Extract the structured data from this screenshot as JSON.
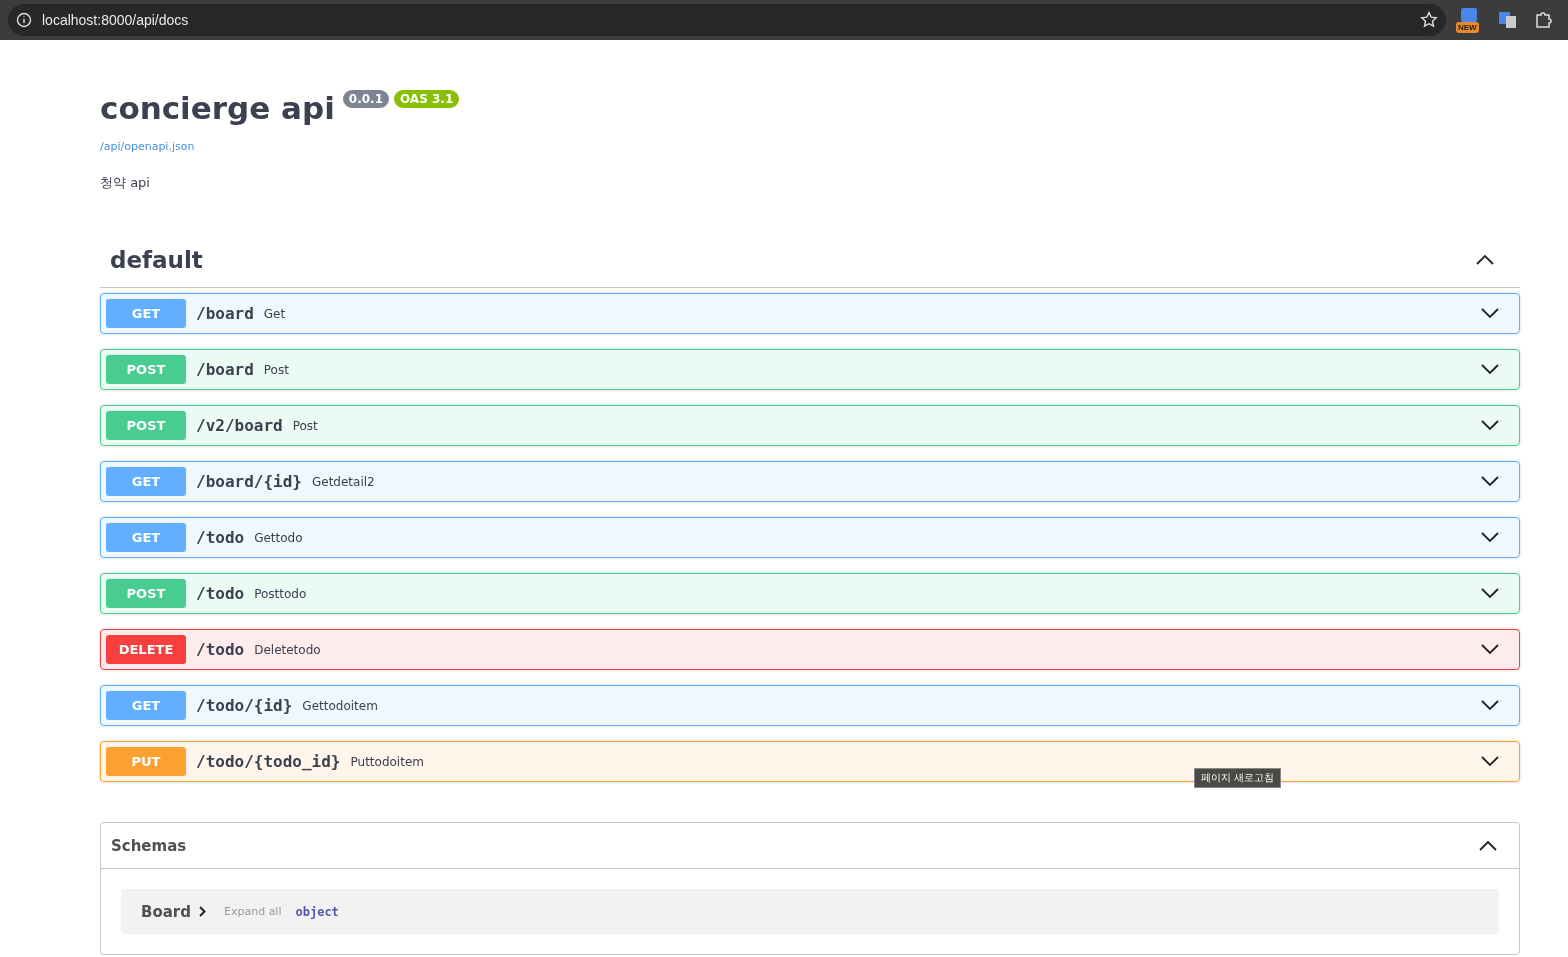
{
  "browser": {
    "url": "localhost:8000/api/docs",
    "extension_badge": "NEW"
  },
  "info": {
    "title": "concierge api",
    "version": "0.0.1",
    "oas": "OAS 3.1",
    "spec_link": "/api/openapi.json",
    "description": "청약 api"
  },
  "section": {
    "name": "default",
    "expanded": true,
    "operations": [
      {
        "method": "GET",
        "kind": "get",
        "path": "/board",
        "summary": "Get",
        "expanded": false
      },
      {
        "method": "POST",
        "kind": "post",
        "path": "/board",
        "summary": "Post",
        "expanded": false
      },
      {
        "method": "POST",
        "kind": "post",
        "path": "/v2/board",
        "summary": "Post",
        "expanded": false
      },
      {
        "method": "GET",
        "kind": "get",
        "path": "/board/{id}",
        "summary": "Getdetail2",
        "expanded": false
      },
      {
        "method": "GET",
        "kind": "get",
        "path": "/todo",
        "summary": "Gettodo",
        "expanded": false
      },
      {
        "method": "POST",
        "kind": "post",
        "path": "/todo",
        "summary": "Posttodo",
        "expanded": false
      },
      {
        "method": "DELETE",
        "kind": "delete",
        "path": "/todo",
        "summary": "Deletetodo",
        "expanded": false
      },
      {
        "method": "GET",
        "kind": "get",
        "path": "/todo/{id}",
        "summary": "Gettodoitem",
        "expanded": false
      },
      {
        "method": "PUT",
        "kind": "put",
        "path": "/todo/{todo_id}",
        "summary": "Puttodoitem",
        "expanded": false
      }
    ]
  },
  "tooltip": "페이지 새로고침",
  "schemas": {
    "title": "Schemas",
    "expanded": true,
    "models": [
      {
        "name": "Board",
        "expand_all": "Expand all",
        "type": "object"
      }
    ]
  }
}
